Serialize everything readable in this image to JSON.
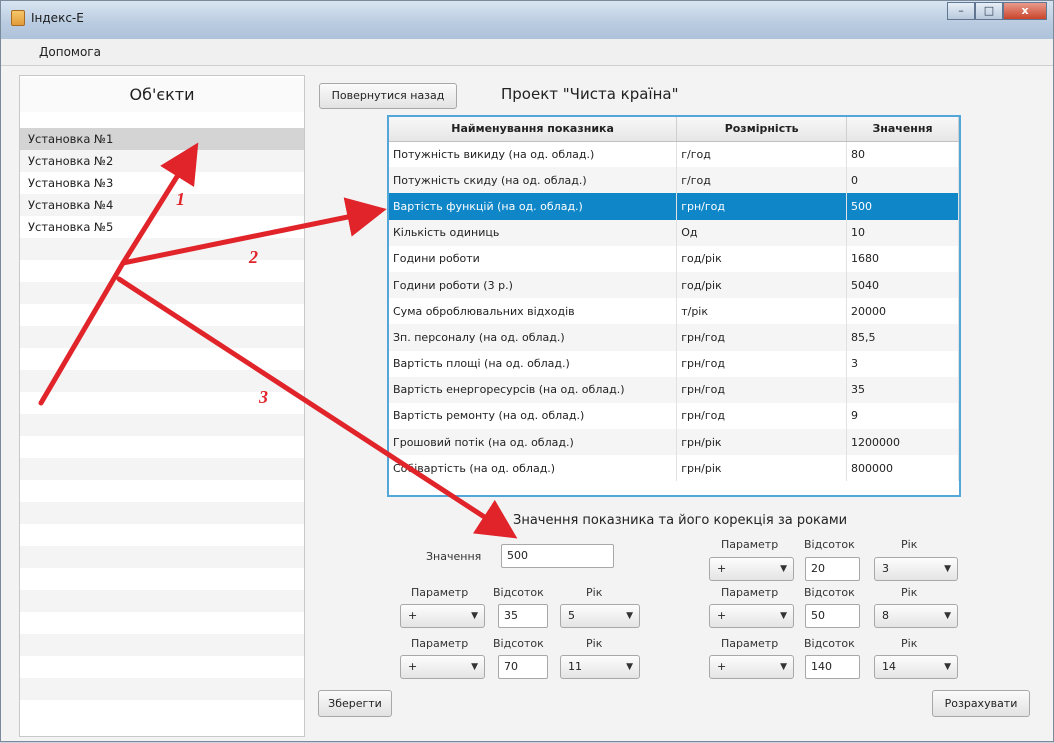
{
  "window": {
    "title": "Індекс-Е",
    "min_label": "–",
    "max_label": "□",
    "close_label": "x"
  },
  "menu": {
    "help_label": "Допомога"
  },
  "sidebar": {
    "heading": "Об'єкти",
    "items": [
      {
        "label": "Установка №1"
      },
      {
        "label": "Установка №2"
      },
      {
        "label": "Установка №3"
      },
      {
        "label": "Установка №4"
      },
      {
        "label": "Установка №5"
      }
    ],
    "selected_index": 0
  },
  "toolbar": {
    "back_label": "Повернутися назад",
    "project_title": "Проект \"Чиста країна\""
  },
  "table": {
    "headers": [
      "Найменування показника",
      "Розмірність",
      "Значення"
    ],
    "rows": [
      [
        "Потужність викиду (на од. облад.)",
        "г/год",
        "80"
      ],
      [
        "Потужність скиду (на од. облад.)",
        "г/год",
        "0"
      ],
      [
        "Вартість функцій  (на од. облад.)",
        "грн/год",
        "500"
      ],
      [
        "Кількість одиниць",
        "Од",
        "10"
      ],
      [
        "Години роботи",
        "год/рік",
        "1680"
      ],
      [
        "Години роботи (3 р.)",
        "год/рік",
        "5040"
      ],
      [
        "Сума оброблювальних відходів",
        "т/рік",
        "20000"
      ],
      [
        "Зп. персоналу (на од. облад.)",
        "грн/год",
        "85,5"
      ],
      [
        "Вартість площі (на од. облад.)",
        "грн/год",
        "3"
      ],
      [
        "Вартість енергоресурсів (на од. облад.)",
        "грн/год",
        "35"
      ],
      [
        "Вартість ремонту (на од. облад.)",
        "грн/год",
        "9"
      ],
      [
        "Грошовий потік (на од. облад.)",
        "грн/рік",
        "1200000"
      ],
      [
        "Собівартість (на од. облад.)",
        "грн/рік",
        "800000"
      ]
    ],
    "selected_row": 2
  },
  "correction": {
    "title": "Значення показника та його корекція за роками",
    "value_label": "Значення",
    "value": "500",
    "param_label": "Параметр",
    "percent_label": "Відсоток",
    "year_label": "Рік",
    "groups": [
      {
        "param": "+",
        "percent": "35",
        "year": "5"
      },
      {
        "param": "+",
        "percent": "70",
        "year": "11"
      },
      {
        "param": "+",
        "percent": "20",
        "year": "3"
      },
      {
        "param": "+",
        "percent": "50",
        "year": "8"
      },
      {
        "param": "+",
        "percent": "140",
        "year": "14"
      }
    ]
  },
  "actions": {
    "save_label": "Зберегти",
    "calc_label": "Розрахувати"
  },
  "annotations": {
    "labels": [
      "1",
      "2",
      "3"
    ],
    "color": "#e0242a"
  }
}
